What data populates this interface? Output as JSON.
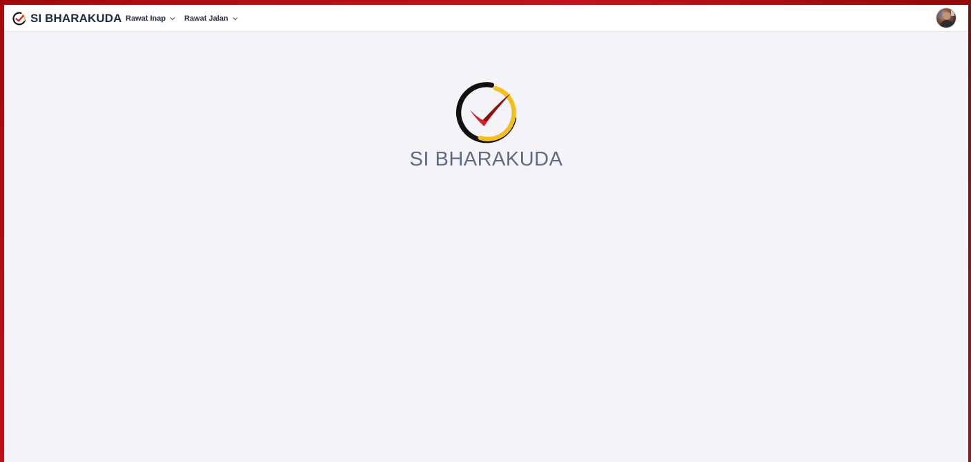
{
  "app": {
    "brand_name": "SI BHARAKUDA",
    "logo_icon": "check-circle-logo-icon"
  },
  "nav": {
    "items": [
      {
        "label": "Rawat Inap",
        "icon": "chevron-down-icon"
      },
      {
        "label": "Rawat Jalan",
        "icon": "chevron-down-icon"
      }
    ]
  },
  "user": {
    "avatar_icon": "user-avatar"
  },
  "hero": {
    "title": "SI BHARAKUDA"
  },
  "colors": {
    "outer_background": "#b50d14",
    "page_background": "#f3f3f8",
    "topbar_background": "#ffffff",
    "brand_text": "#1f2a44",
    "hero_text": "#5d6b84",
    "logo_red": "#d61f26",
    "logo_yellow": "#f2c01c",
    "logo_black": "#111111"
  }
}
